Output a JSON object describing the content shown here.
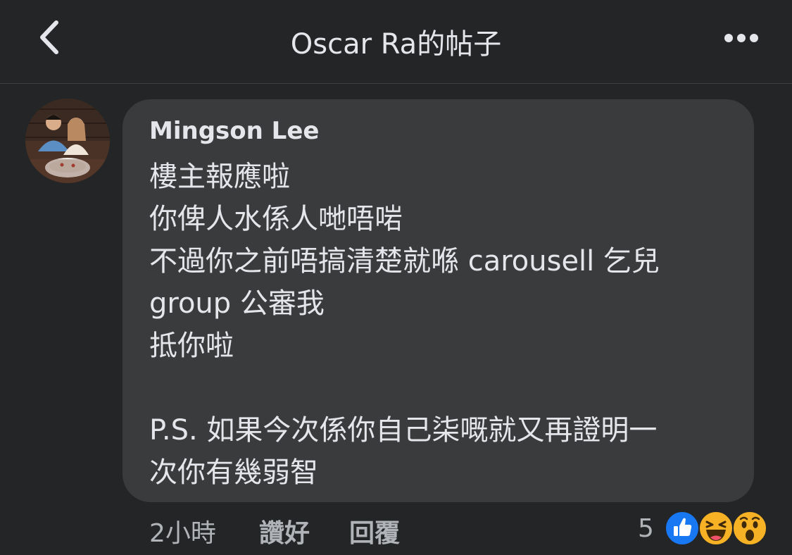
{
  "header": {
    "title": "Oscar Ra的帖子",
    "back_icon": "chevron-left-icon",
    "more_icon": "more-horizontal-icon"
  },
  "comment": {
    "author": "Mingson Lee",
    "lines": [
      "樓主報應啦",
      "你俾人水係人哋唔啱",
      "不過你之前唔搞清楚就喺 carousell 乞兒",
      "group 公審我",
      "抵你啦",
      "",
      "P.S. 如果今次係你自己柒嘅就又再證明一",
      "次你有幾弱智"
    ],
    "time": "2小時",
    "like_label": "讚好",
    "reply_label": "回覆",
    "reaction_count": "5",
    "reactions": [
      "like-icon",
      "haha-icon",
      "wow-icon"
    ]
  },
  "colors": {
    "background": "#242526",
    "bubble": "#3a3b3c",
    "text": "#e4e6eb",
    "secondary_text": "#b0b3b8",
    "like_blue": "#1877f2",
    "emoji_yellow": "#f7b125"
  }
}
